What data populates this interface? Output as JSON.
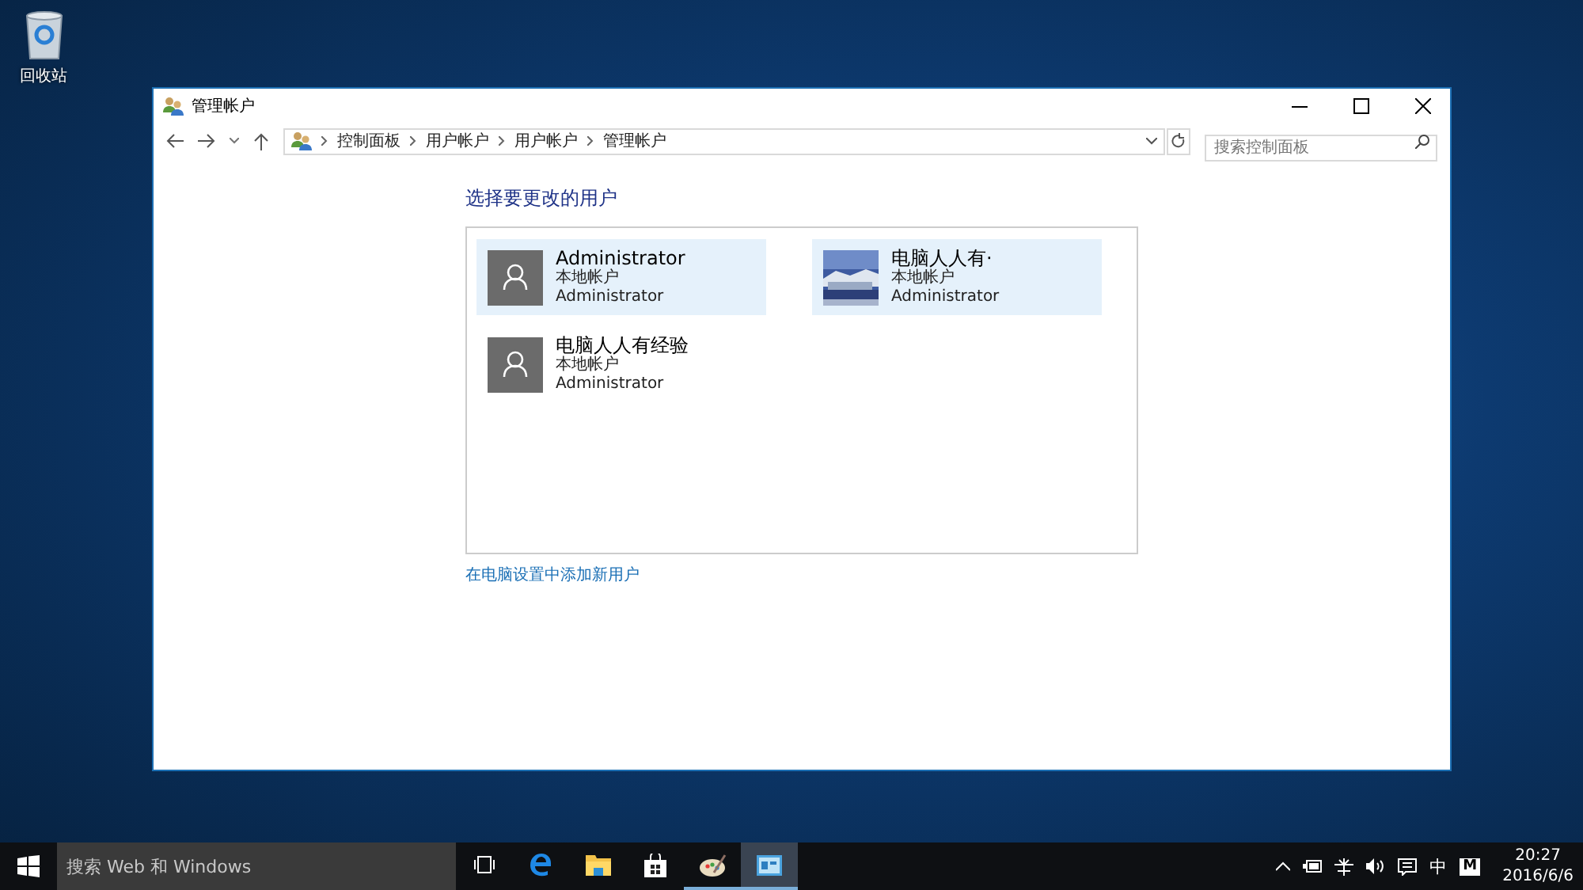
{
  "desktop_icons": [
    {
      "label": "回收站"
    }
  ],
  "window": {
    "title": "管理帐户",
    "breadcrumb": [
      "控制面板",
      "用户帐户",
      "用户帐户",
      "管理帐户"
    ],
    "search": {
      "placeholder": "搜索控制面板"
    },
    "heading": "选择要更改的用户",
    "accounts": [
      {
        "name": "Administrator",
        "type": "本地帐户",
        "role": "Administrator",
        "kind": "default",
        "selected": true
      },
      {
        "name": "电脑人人有·",
        "type": "本地帐户",
        "role": "Administrator",
        "kind": "picture",
        "selected": true
      },
      {
        "name": "电脑人人有经验",
        "type": "本地帐户",
        "role": "Administrator",
        "kind": "default",
        "selected": false
      }
    ],
    "add_link": "在电脑设置中添加新用户"
  },
  "taskbar": {
    "search": {
      "placeholder": "搜索 Web 和 Windows"
    },
    "apps": [
      {
        "kind": "taskview",
        "running": false,
        "active": false
      },
      {
        "kind": "edge",
        "running": false,
        "active": false
      },
      {
        "kind": "explorer",
        "running": false,
        "active": false
      },
      {
        "kind": "store",
        "running": false,
        "active": false
      },
      {
        "kind": "paint",
        "running": true,
        "active": false
      },
      {
        "kind": "control",
        "running": true,
        "active": true
      }
    ],
    "ime": "中",
    "ime_mode": "M",
    "time": "20:27",
    "date": "2016/6/6"
  }
}
